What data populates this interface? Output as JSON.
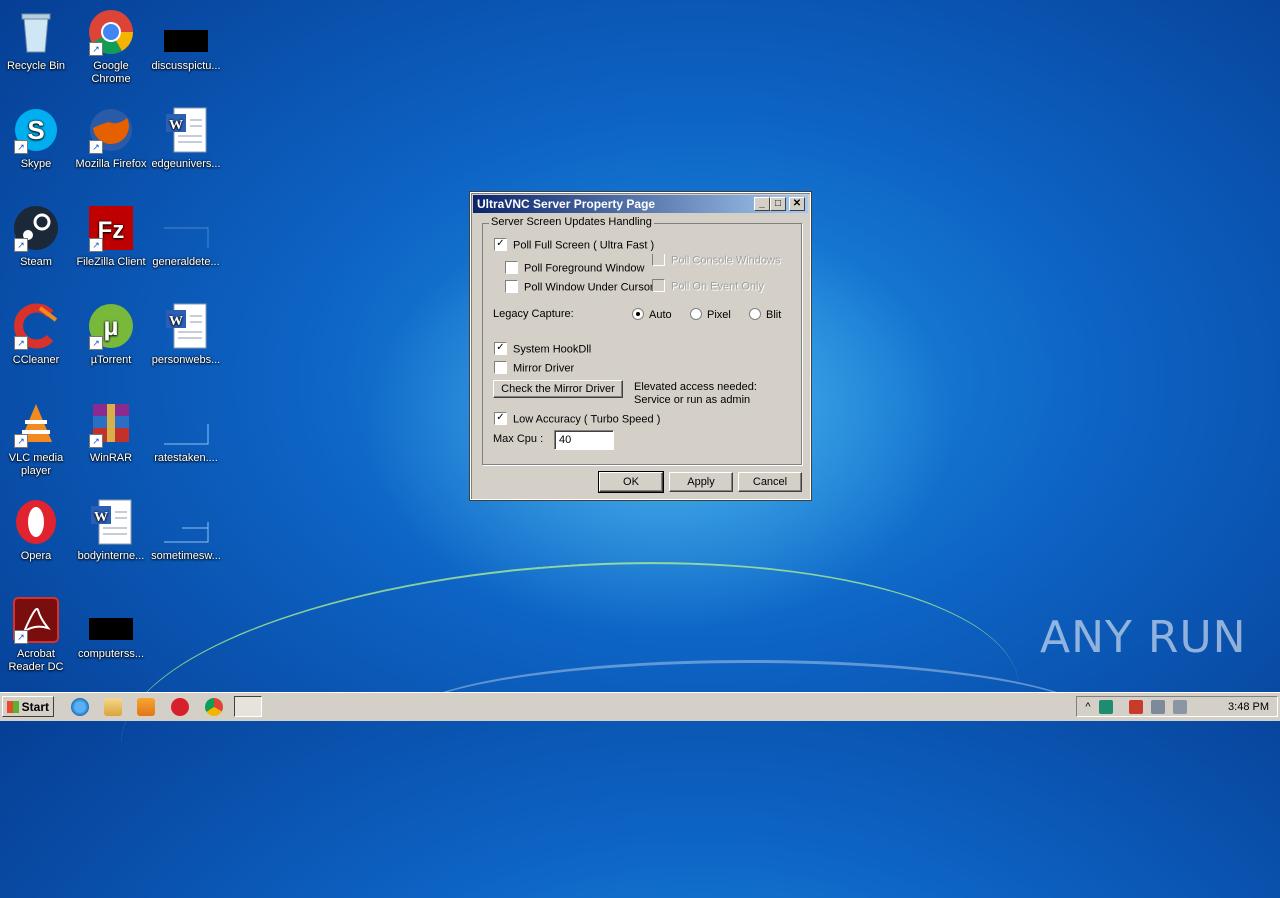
{
  "desktop_icons": [
    {
      "label": "Recycle Bin",
      "icon": "recycle-bin-icon"
    },
    {
      "label": "Google Chrome",
      "icon": "chrome-icon"
    },
    {
      "label": "discusspictu...",
      "icon": "file-icon"
    },
    {
      "label": "Skype",
      "icon": "skype-icon"
    },
    {
      "label": "Mozilla Firefox",
      "icon": "firefox-icon"
    },
    {
      "label": "edgeunivers...",
      "icon": "word-doc-icon"
    },
    {
      "label": "Steam",
      "icon": "steam-icon"
    },
    {
      "label": "FileZilla Client",
      "icon": "filezilla-icon"
    },
    {
      "label": "generaldete...",
      "icon": "file-icon"
    },
    {
      "label": "CCleaner",
      "icon": "ccleaner-icon"
    },
    {
      "label": "µTorrent",
      "icon": "utorrent-icon"
    },
    {
      "label": "personwebs...",
      "icon": "word-doc-icon"
    },
    {
      "label": "VLC media player",
      "icon": "vlc-icon"
    },
    {
      "label": "WinRAR",
      "icon": "winrar-icon"
    },
    {
      "label": "ratestaken....",
      "icon": "file-icon"
    },
    {
      "label": "Opera",
      "icon": "opera-icon"
    },
    {
      "label": "bodyinterne...",
      "icon": "word-doc-icon"
    },
    {
      "label": "sometimesw...",
      "icon": "file-icon"
    },
    {
      "label": "Acrobat Reader DC",
      "icon": "acrobat-icon"
    },
    {
      "label": "computerss...",
      "icon": "file-icon"
    }
  ],
  "dialog": {
    "title": "UltraVNC Server Property Page",
    "group_title": "Server Screen Updates Handling",
    "poll_full_screen": {
      "label": "Poll Full Screen ( Ultra Fast )",
      "checked": true
    },
    "poll_foreground": {
      "label": "Poll Foreground Window",
      "checked": false
    },
    "poll_under_cursor": {
      "label": "Poll Window Under Cursor",
      "checked": false
    },
    "poll_console": {
      "label": "Poll Console Windows Only",
      "checked": false
    },
    "poll_on_event": {
      "label": "Poll On Event Only",
      "checked": false
    },
    "legacy_capture_label": "Legacy Capture:",
    "legacy_options": [
      "Auto",
      "Pixel",
      "Blit"
    ],
    "legacy_selected": "Auto",
    "system_hookdll": {
      "label": "System HookDll",
      "checked": true
    },
    "mirror_driver": {
      "label": "Mirror Driver",
      "checked": false
    },
    "check_mirror_button": "Check the Mirror Driver",
    "elevated_note": "Elevated access needed: Service or run as admin",
    "low_accuracy": {
      "label": "Low Accuracy ( Turbo Speed )",
      "checked": true
    },
    "max_cpu_label": "Max Cpu :",
    "max_cpu_value": "40",
    "ok_button": "OK",
    "apply_button": "Apply",
    "cancel_button": "Cancel"
  },
  "taskbar": {
    "start_label": "Start",
    "clock": "3:48 PM",
    "pinned": [
      "ie-icon",
      "explorer-icon",
      "media-player-icon",
      "opera-icon",
      "chrome-icon",
      "vnc-window-icon"
    ]
  },
  "watermark": "ANY RUN",
  "colors": {
    "titlebar_start": "#0a246a",
    "titlebar_end": "#a6caf0",
    "desktop_blue": "#0d63c4"
  }
}
